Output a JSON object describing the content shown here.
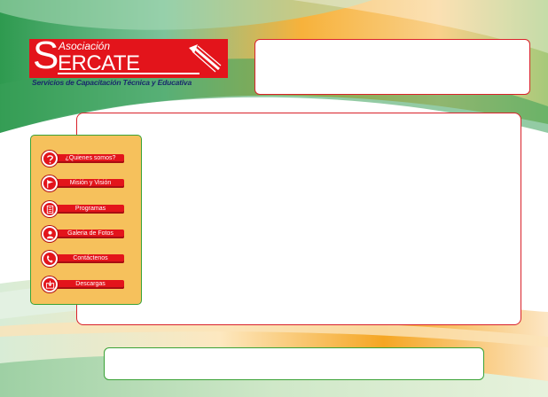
{
  "brand": {
    "small": "Asociación",
    "letter": "S",
    "name": "ERCATE",
    "tagline": "Servicios de Capacitación Técnica y Educativa"
  },
  "menu": [
    {
      "label": "¿Quienes somos?",
      "icon": "question-icon"
    },
    {
      "label": "Misión y Visión",
      "icon": "flag-icon"
    },
    {
      "label": "Programas",
      "icon": "document-icon"
    },
    {
      "label": "Galeria de Fotos",
      "icon": "person-icon"
    },
    {
      "label": "Contáctenos",
      "icon": "phone-icon"
    },
    {
      "label": "Descargas",
      "icon": "download-icon"
    }
  ],
  "colors": {
    "accent_red": "#e3141b",
    "frame_green": "#3aa236",
    "sidebar_orange": "#f6c15c",
    "tagline_navy": "#1a2a6c"
  }
}
